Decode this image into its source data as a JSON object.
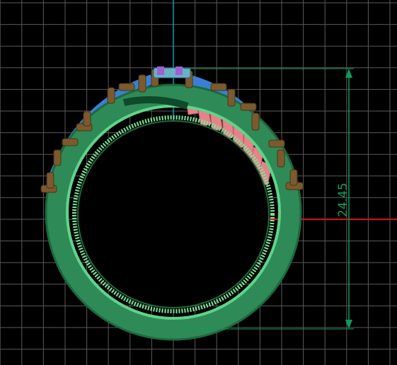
{
  "viewport": {
    "background": "#000000",
    "grid_color": "#5a5a5a",
    "x_axis_color": "#d21414",
    "y_axis_color": "#00a0b4"
  },
  "dimension": {
    "value": "24.45",
    "color": "#0f9a5a"
  },
  "model": {
    "shank_color": "#2e8b57",
    "shank_highlight": "#5fd48a",
    "inner_band_color": "#7ee69a",
    "stone_color": "#3a7fd5",
    "prong_color": "#7a5a2e",
    "setting_color": "#e8828a",
    "center_stone_color": "#a060d0"
  }
}
